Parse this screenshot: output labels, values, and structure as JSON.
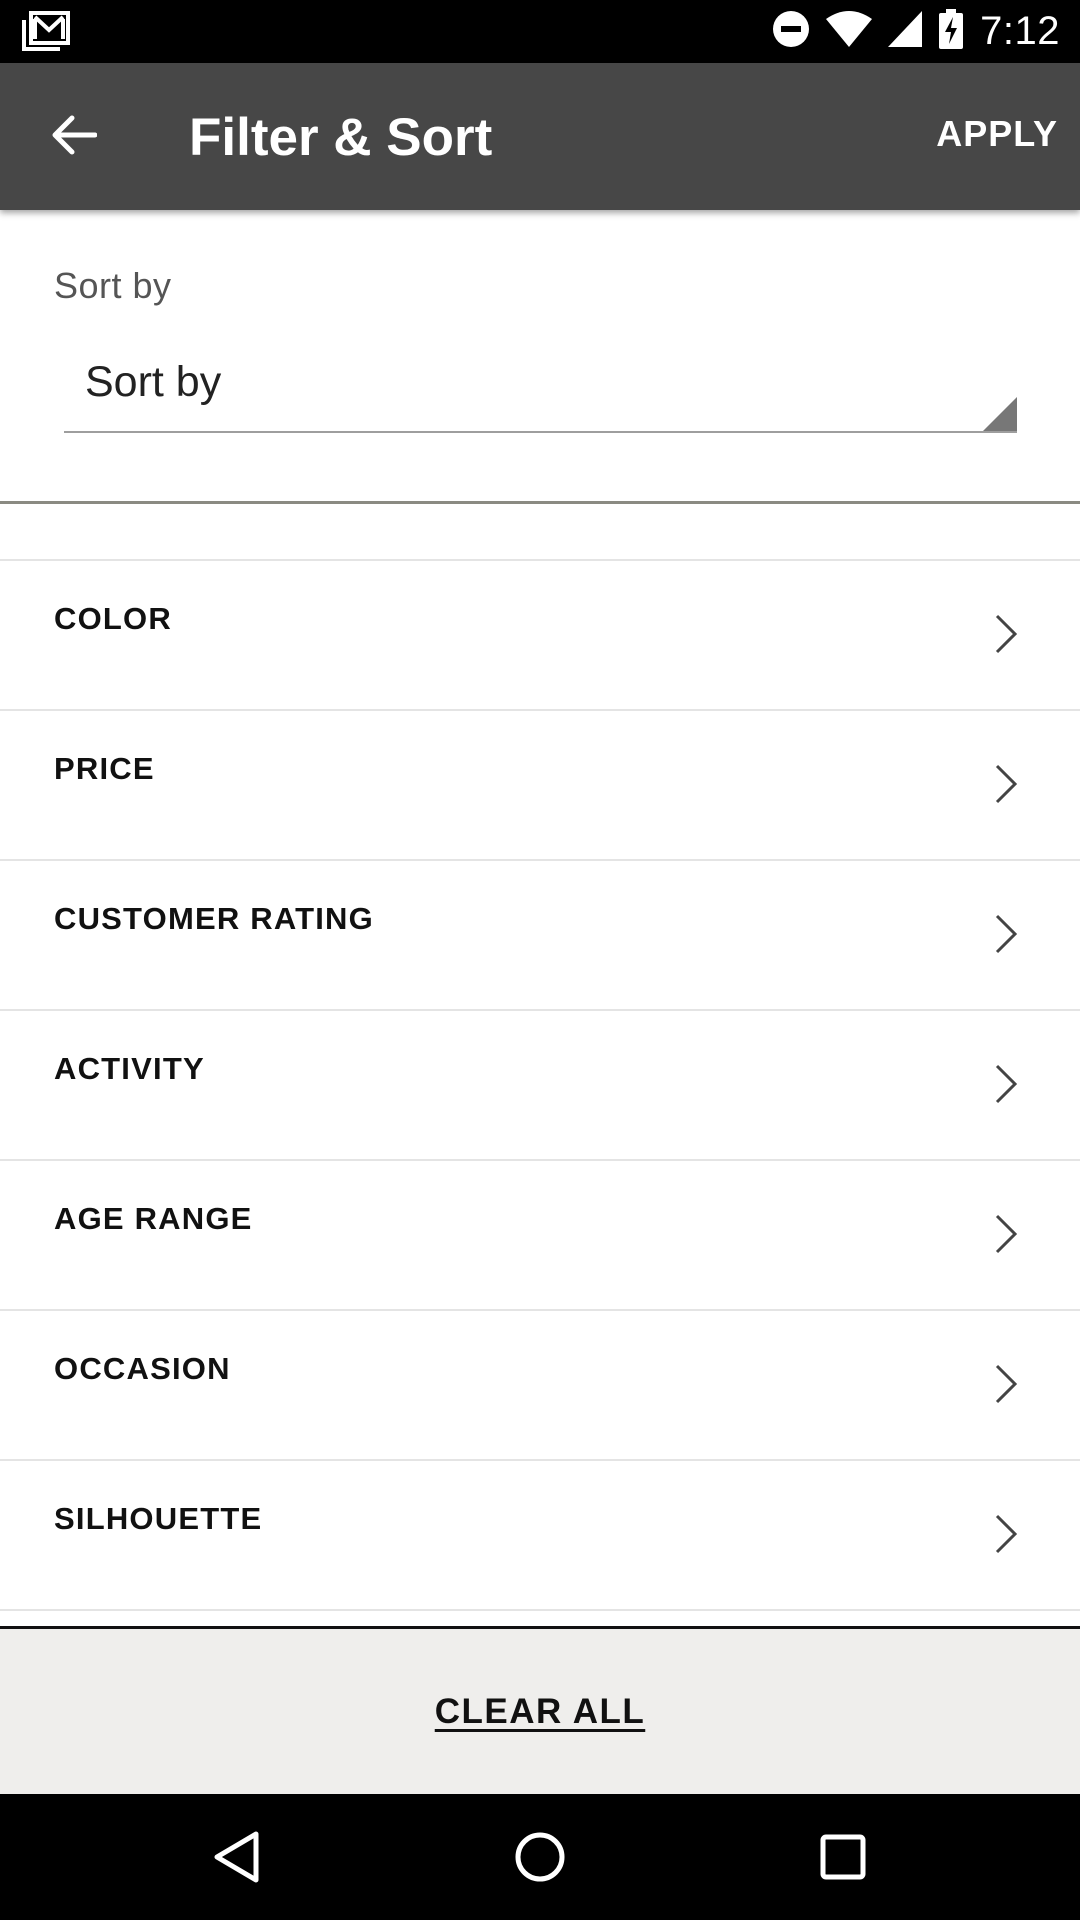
{
  "status_bar": {
    "time": "7:12",
    "icons": [
      "gmail-icon",
      "do-not-disturb-icon",
      "wifi-icon",
      "signal-icon",
      "battery-charging-icon"
    ]
  },
  "app_bar": {
    "title": "Filter & Sort",
    "apply_label": "APPLY",
    "background": "#474747"
  },
  "sort": {
    "label": "Sort by",
    "selected_value": "Sort by"
  },
  "filters": [
    {
      "label": "COLOR"
    },
    {
      "label": "PRICE"
    },
    {
      "label": "CUSTOMER RATING"
    },
    {
      "label": "ACTIVITY"
    },
    {
      "label": "AGE RANGE"
    },
    {
      "label": "OCCASION"
    },
    {
      "label": "SILHOUETTE"
    }
  ],
  "footer": {
    "clear_all_label": "CLEAR ALL"
  },
  "nav_bar": {
    "icons": [
      "back-triangle-icon",
      "home-circle-icon",
      "recents-square-icon"
    ]
  }
}
